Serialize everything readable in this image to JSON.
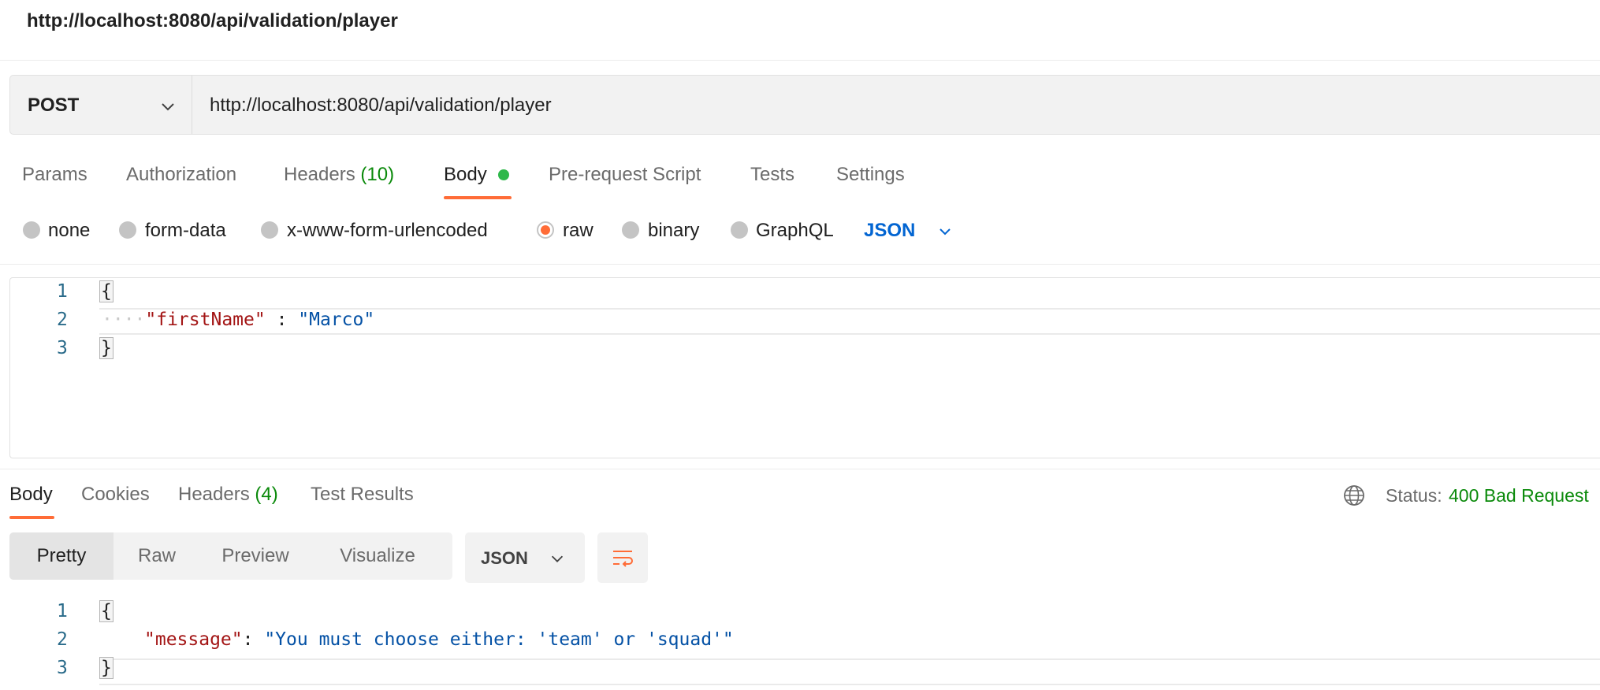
{
  "title": "http://localhost:8080/api/validation/player",
  "request": {
    "method": "POST",
    "url": "http://localhost:8080/api/validation/player"
  },
  "request_tabs": {
    "params": "Params",
    "authorization": "Authorization",
    "headers": "Headers",
    "headers_count": "(10)",
    "body": "Body",
    "prerequest": "Pre-request Script",
    "tests": "Tests",
    "settings": "Settings"
  },
  "body_modes": {
    "none": "none",
    "form_data": "form-data",
    "urlencoded": "x-www-form-urlencoded",
    "raw": "raw",
    "binary": "binary",
    "graphql": "GraphQL",
    "selected": "raw",
    "language": "JSON"
  },
  "request_body": {
    "line_numbers": [
      "1",
      "2",
      "3"
    ],
    "open_brace": "{",
    "indent": "····",
    "key": "\"firstName\"",
    "separator": " : ",
    "value": "\"Marco\"",
    "close_brace": "}"
  },
  "response_tabs": {
    "body": "Body",
    "cookies": "Cookies",
    "headers": "Headers",
    "headers_count": "(4)",
    "test_results": "Test Results"
  },
  "status": {
    "label": "Status:",
    "value": "400 Bad Request",
    "color": "#0b8a0b"
  },
  "response_toolbar": {
    "views": [
      "Pretty",
      "Raw",
      "Preview",
      "Visualize"
    ],
    "selected_view": "Pretty",
    "format": "JSON"
  },
  "response_body": {
    "line_numbers": [
      "1",
      "2",
      "3"
    ],
    "open_brace": "{",
    "key": "\"message\"",
    "separator": ": ",
    "value": "\"You must choose either: 'team' or 'squad'\"",
    "close_brace": "}"
  },
  "colors": {
    "accent": "#ff6c37",
    "json_blue": "#0265d2",
    "success_green": "#0b8a0b",
    "dot_green": "#2eb84a"
  },
  "icons": [
    "chevron-down-icon",
    "globe-icon",
    "wrap-lines-icon"
  ]
}
